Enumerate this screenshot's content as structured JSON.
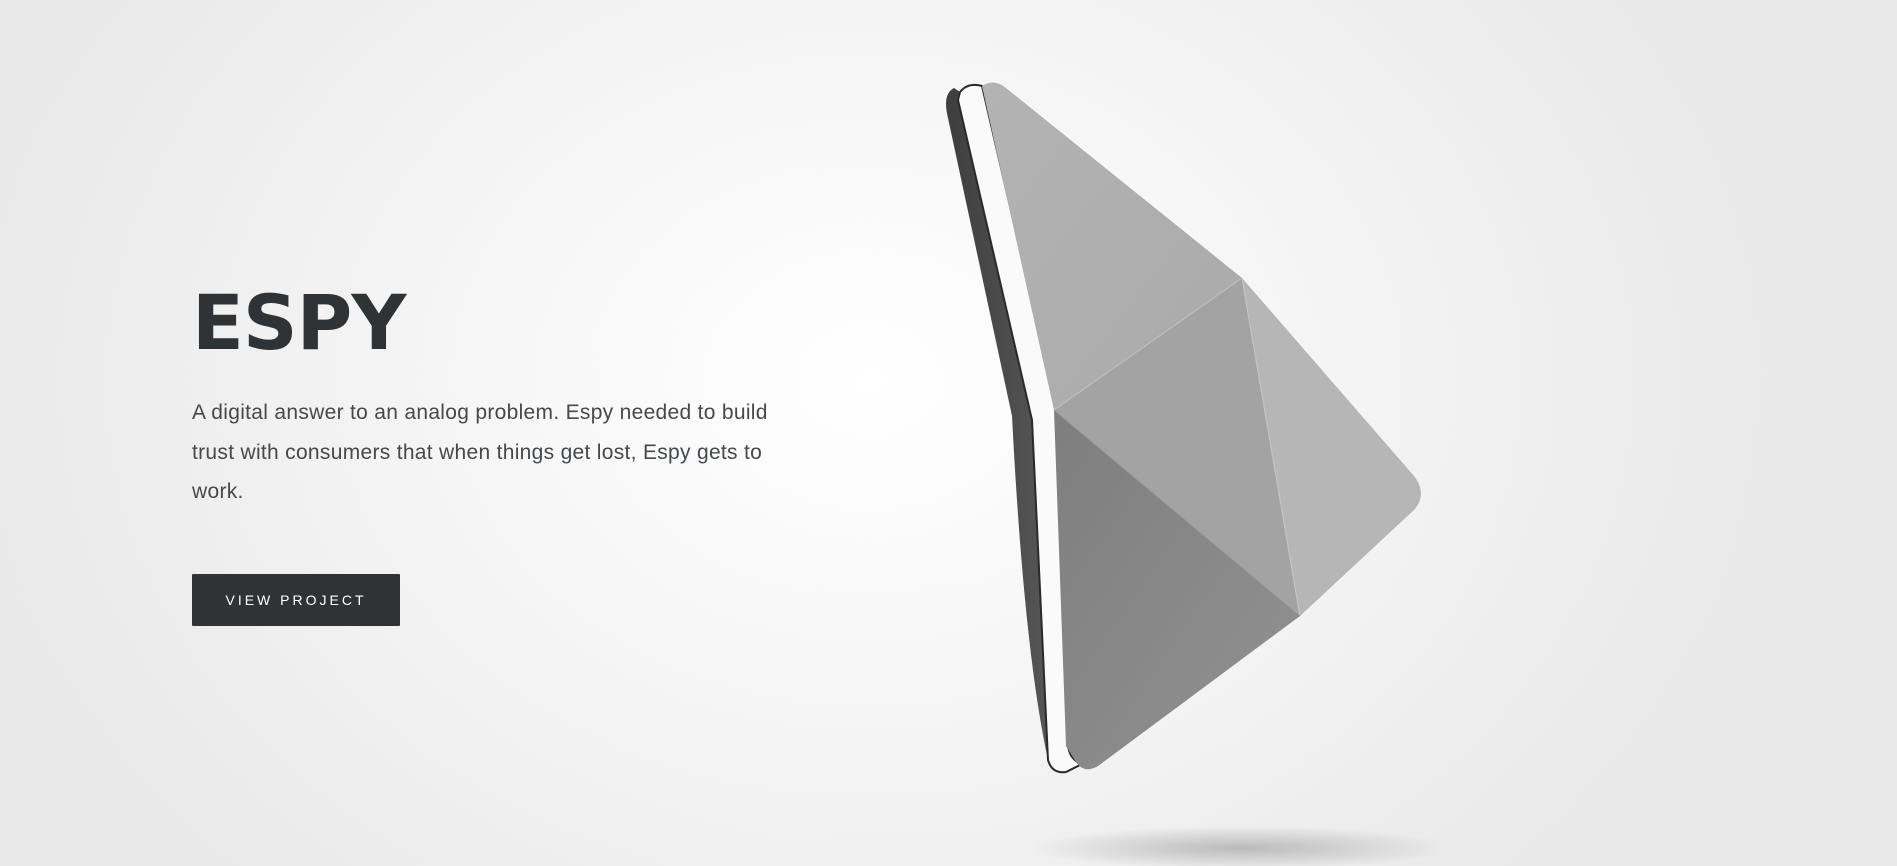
{
  "hero": {
    "title": "ESPY",
    "description": "A digital answer to an analog problem. Espy needed to build trust with consumers that when things get lost, Espy gets to work.",
    "cta_label": "VIEW PROJECT"
  },
  "colors": {
    "heading": "#2f3336",
    "body_text": "#45494c",
    "button_background": "#2f3336",
    "button_text": "#ffffff",
    "device_gray": "#a8a8a8"
  },
  "illustration": {
    "subject": "espy-tracker-device",
    "icon": "triangular-device-render"
  }
}
